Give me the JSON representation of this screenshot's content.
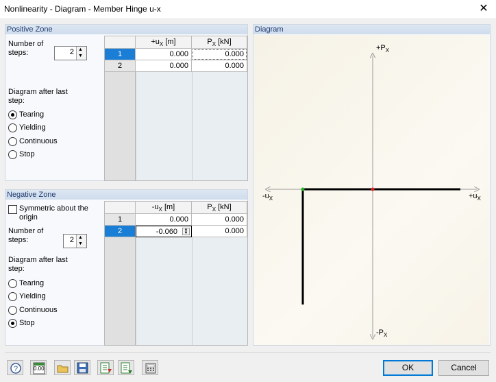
{
  "window": {
    "title": "Nonlinearity - Diagram - Member Hinge u-x",
    "close_glyph": "✕"
  },
  "positive_zone": {
    "header": "Positive Zone",
    "steps_label": "Number of steps:",
    "steps_value": "2",
    "after_label": "Diagram after last step:",
    "options": [
      "Tearing",
      "Yielding",
      "Continuous",
      "Stop"
    ],
    "selected": "Tearing",
    "table": {
      "col1": "+u",
      "col1_sub": "X",
      "col1_unit": " [m]",
      "col2": "P",
      "col2_sub": "X",
      "col2_unit": " [kN]",
      "rows": [
        {
          "n": "1",
          "u": "0.000",
          "p": "0.000"
        },
        {
          "n": "2",
          "u": "0.000",
          "p": "0.000"
        }
      ]
    }
  },
  "negative_zone": {
    "header": "Negative Zone",
    "symmetric_label": "Symmetric about the origin",
    "symmetric_checked": false,
    "steps_label": "Number of steps:",
    "steps_value": "2",
    "after_label": "Diagram after last step:",
    "options": [
      "Tearing",
      "Yielding",
      "Continuous",
      "Stop"
    ],
    "selected": "Stop",
    "table": {
      "col1": "-u",
      "col1_sub": "X",
      "col1_unit": " [m]",
      "col2": "P",
      "col2_sub": "X",
      "col2_unit": " [kN]",
      "rows": [
        {
          "n": "1",
          "u": "0.000",
          "p": "0.000"
        },
        {
          "n": "2",
          "u": "-0.060",
          "p": "0.000"
        }
      ]
    }
  },
  "diagram": {
    "header": "Diagram",
    "axis_top": "+P",
    "axis_top_sub": "X",
    "axis_bottom": "-P",
    "axis_bottom_sub": "X",
    "axis_left": "-u",
    "axis_left_sub": "X",
    "axis_right": "+u",
    "axis_right_sub": "X",
    "line_color": "#000000",
    "point_origin_color": "#e02020",
    "point_neg_color": "#22b322"
  },
  "footer": {
    "ok": "OK",
    "cancel": "Cancel",
    "tools": [
      "help-icon",
      "units-icon",
      "open-icon",
      "save-icon",
      "import-icon",
      "export-icon",
      "calculator-icon"
    ],
    "units_text": "0.00"
  }
}
